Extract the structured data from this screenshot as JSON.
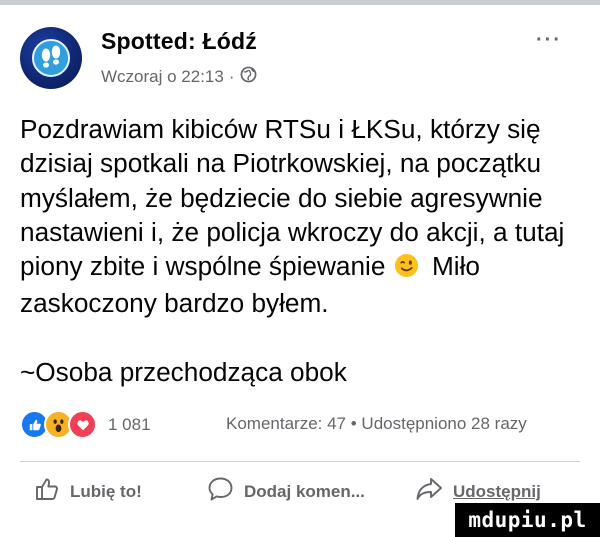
{
  "post": {
    "page_name": "Spotted: Łódź",
    "time": "Wczoraj o 22:13",
    "separator": "·",
    "more_label": "···",
    "text_lines": [
      "Pozdrawiam kibiców RTSu i ŁKSu, którzy się",
      "dzisiaj spotkali na Piotrkowskiej, na początku",
      "myślałem, że będziecie do siebie agresywnie",
      "nastawieni i, że policja wkroczy do akcji, a tutaj",
      "piony zbite i wspólne śpiewanie",
      "Miło",
      "zaskoczony bardzo byłem."
    ],
    "signature": "~Osoba przechodząca obok"
  },
  "engagement": {
    "reactions_count": "1 081",
    "stats": "Komentarze: 47 • Udostępniono 28 razy"
  },
  "actions": {
    "like": "Lubię to!",
    "comment": "Dodaj komen...",
    "share": "Udostępnij"
  },
  "watermark": "mdupiu.pl",
  "icons": {
    "avatar": "footprints-logo-icon",
    "audience": "globe-icon",
    "emoji": "winking-face-icon",
    "reactions": [
      "like-reaction-icon",
      "wow-reaction-icon",
      "love-reaction-icon"
    ],
    "like": "thumbs-up-icon",
    "comment": "speech-bubble-icon",
    "share": "share-arrow-icon"
  },
  "colors": {
    "secondary_text": "#65676b",
    "like_blue": "#1877f2",
    "love_red": "#f33e58",
    "wow_yellow": "#f7b125"
  }
}
